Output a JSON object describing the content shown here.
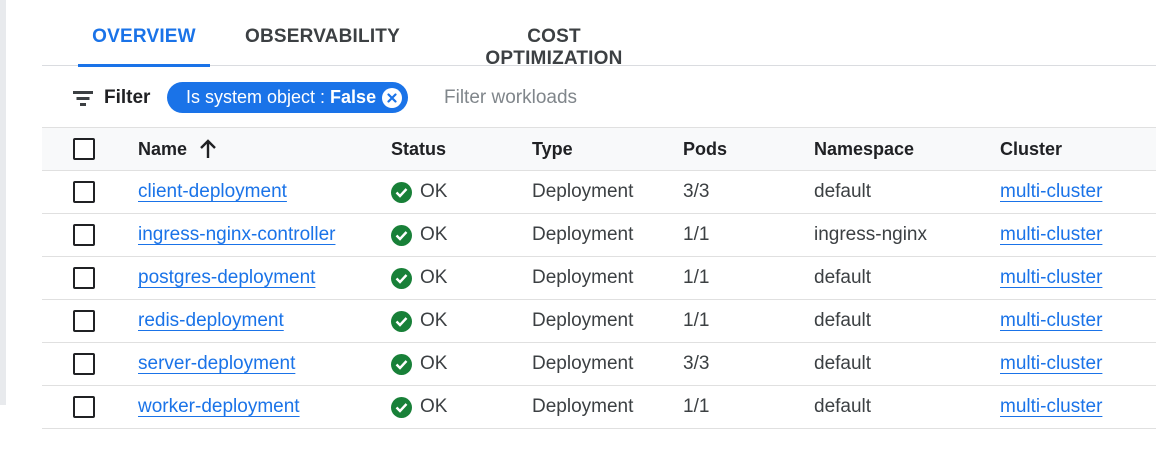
{
  "tabs": [
    {
      "label": "OVERVIEW",
      "active": true
    },
    {
      "label": "OBSERVABILITY",
      "active": false
    },
    {
      "label": "COST OPTIMIZATION",
      "active": false
    }
  ],
  "filter": {
    "label": "Filter",
    "icon": "filter-list-icon",
    "chip": {
      "key": "Is system object : ",
      "value": "False",
      "close_icon": "cancel-circle-icon"
    },
    "placeholder": "Filter workloads"
  },
  "table": {
    "columns": {
      "name": "Name",
      "name_sort_icon": "arrow-upward-icon",
      "status": "Status",
      "type": "Type",
      "pods": "Pods",
      "namespace": "Namespace",
      "cluster": "Cluster"
    },
    "rows": [
      {
        "name": "client-deployment",
        "status": "OK",
        "type": "Deployment",
        "pods": "3/3",
        "namespace": "default",
        "cluster": "multi-cluster"
      },
      {
        "name": "ingress-nginx-controller",
        "status": "OK",
        "type": "Deployment",
        "pods": "1/1",
        "namespace": "ingress-nginx",
        "cluster": "multi-cluster"
      },
      {
        "name": "postgres-deployment",
        "status": "OK",
        "type": "Deployment",
        "pods": "1/1",
        "namespace": "default",
        "cluster": "multi-cluster"
      },
      {
        "name": "redis-deployment",
        "status": "OK",
        "type": "Deployment",
        "pods": "1/1",
        "namespace": "default",
        "cluster": "multi-cluster"
      },
      {
        "name": "server-deployment",
        "status": "OK",
        "type": "Deployment",
        "pods": "3/3",
        "namespace": "default",
        "cluster": "multi-cluster"
      },
      {
        "name": "worker-deployment",
        "status": "OK",
        "type": "Deployment",
        "pods": "1/1",
        "namespace": "default",
        "cluster": "multi-cluster"
      }
    ]
  },
  "colors": {
    "accent": "#1a73e8",
    "ok": "#188038",
    "text": "#202124",
    "header_bg": "#f8f9fa"
  }
}
